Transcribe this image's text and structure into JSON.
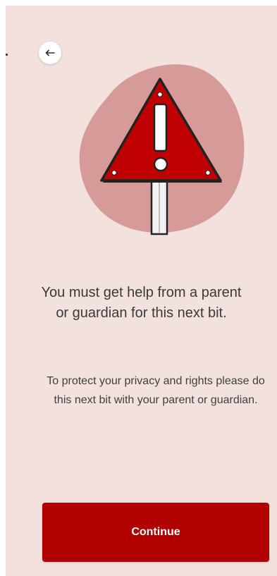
{
  "screen": {
    "background_color": "#f3e1de"
  },
  "header": {
    "back_icon": "arrow-left-icon"
  },
  "illustration": {
    "icon": "warning-sign-icon",
    "blob_color": "#d69a98",
    "sign_color": "#c00000"
  },
  "content": {
    "headline": "You must get help from a parent or guardian for this next bit.",
    "body": "To protect your privacy and rights please do this next bit with your parent or guardian."
  },
  "actions": {
    "continue_label": "Continue",
    "continue_color": "#b00000"
  }
}
